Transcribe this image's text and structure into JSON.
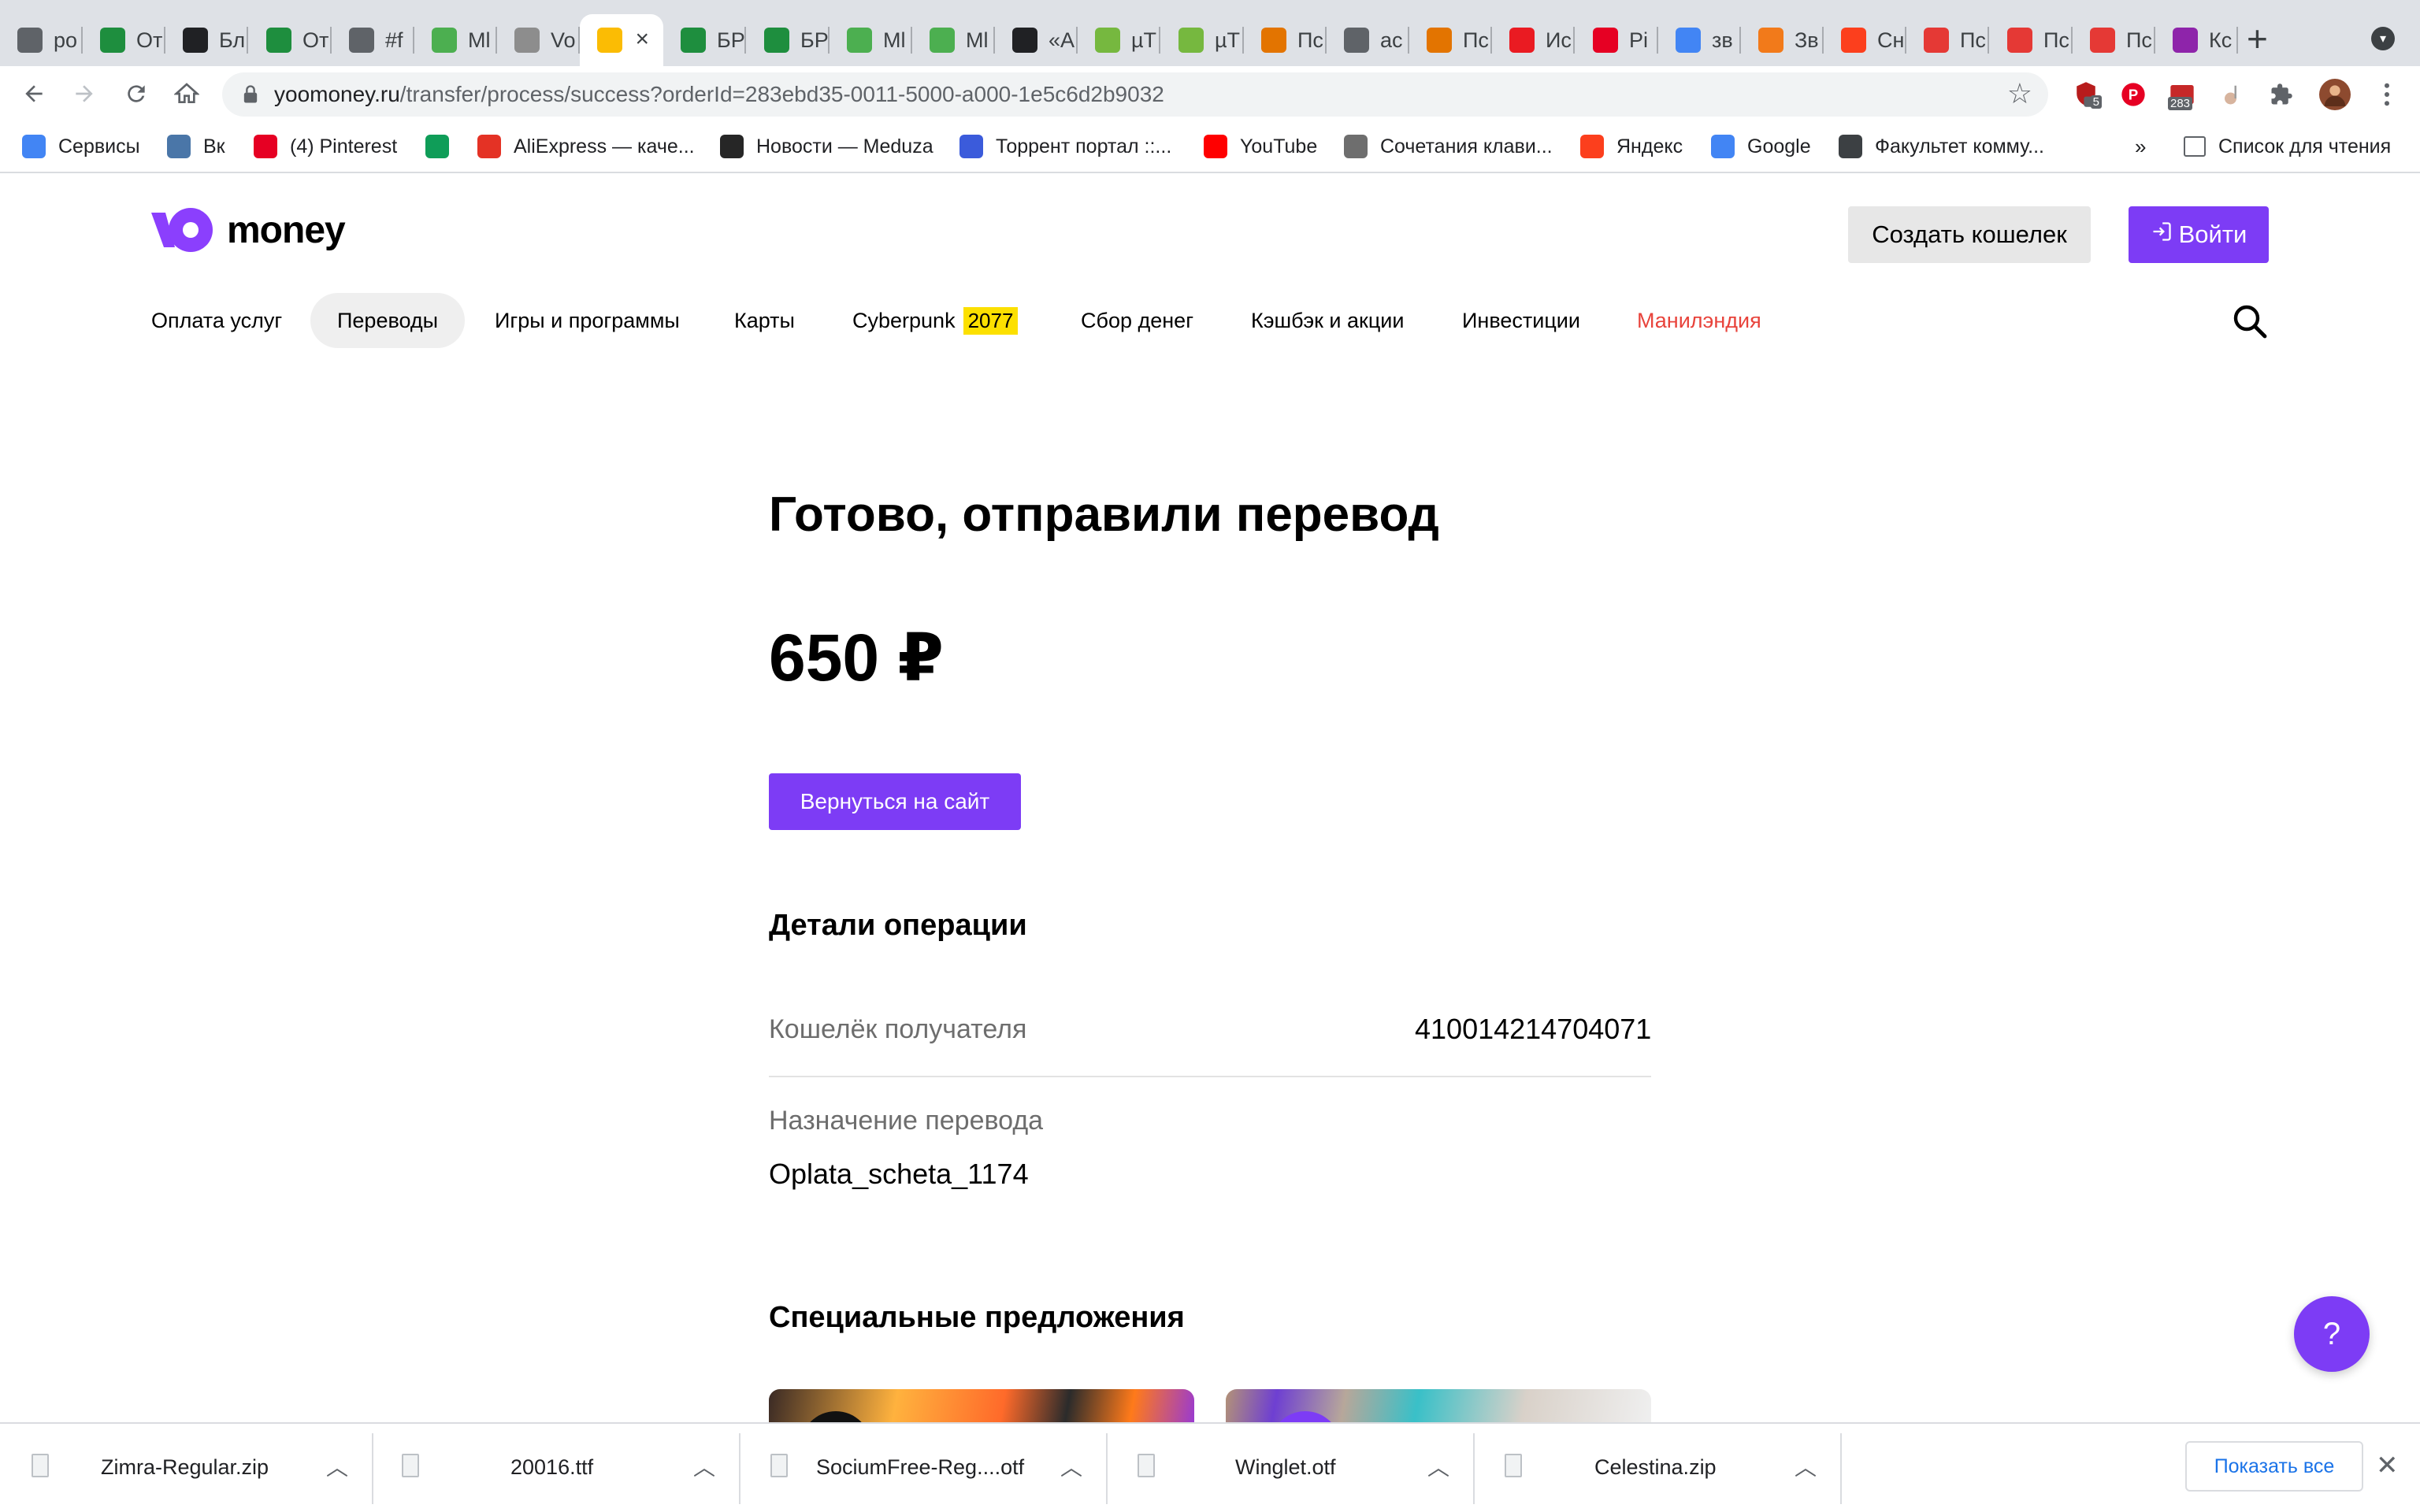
{
  "browser": {
    "tabs": [
      {
        "title": "ро",
        "icon": "feather-icon",
        "color": "#5f6368"
      },
      {
        "title": "От",
        "icon": "sheets-icon",
        "color": "#1e8e3e"
      },
      {
        "title": "Бл",
        "icon": "dark-circle-icon",
        "color": "#202124"
      },
      {
        "title": "От",
        "icon": "sheets-icon",
        "color": "#1e8e3e"
      },
      {
        "title": "#f",
        "icon": "magnet-icon",
        "color": "#5f6368"
      },
      {
        "title": "Ml",
        "icon": "play-icon",
        "color": "#4caf50"
      },
      {
        "title": "Vo",
        "icon": "globe-icon",
        "color": "#8d8d8d"
      },
      {
        "title": "",
        "icon": "warning-icon",
        "color": "#fbbc04",
        "active": true
      },
      {
        "title": "БР",
        "icon": "sheets-icon",
        "color": "#1e8e3e"
      },
      {
        "title": "БР",
        "icon": "sheets-icon",
        "color": "#1e8e3e"
      },
      {
        "title": "Ml",
        "icon": "play-icon",
        "color": "#4caf50"
      },
      {
        "title": "Ml",
        "icon": "play-icon",
        "color": "#4caf50"
      },
      {
        "title": "«А",
        "icon": "yellow-bolt-icon",
        "color": "#202124"
      },
      {
        "title": "µТ",
        "icon": "utorrent-icon",
        "color": "#76b83f"
      },
      {
        "title": "µТ",
        "icon": "utorrent-icon",
        "color": "#76b83f"
      },
      {
        "title": "Пс",
        "icon": "b-icon",
        "color": "#e37400"
      },
      {
        "title": "ас",
        "icon": "globe-icon",
        "color": "#5f6368"
      },
      {
        "title": "Пс",
        "icon": "b-icon",
        "color": "#e37400"
      },
      {
        "title": "Ис",
        "icon": "adobe-icon",
        "color": "#ea1b22"
      },
      {
        "title": "Pi",
        "icon": "pinterest-icon",
        "color": "#e60023"
      },
      {
        "title": "зв",
        "icon": "google-icon",
        "color": "#4285f4"
      },
      {
        "title": "Зв",
        "icon": "bars-icon",
        "color": "#f27a1a"
      },
      {
        "title": "Сн",
        "icon": "yandex-icon",
        "color": "#fc3f1d"
      },
      {
        "title": "Пс",
        "icon": "chart-icon",
        "color": "#e53935"
      },
      {
        "title": "Пс",
        "icon": "chart-icon",
        "color": "#e53935"
      },
      {
        "title": "Пс",
        "icon": "chart-icon",
        "color": "#e53935"
      },
      {
        "title": "Кс",
        "icon": "w-icon",
        "color": "#8e24aa"
      }
    ],
    "new_tab": "+",
    "url_host": "yoomoney.ru",
    "url_path": "/transfer/process/success?orderId=283ebd35-0011-5000-a000-1e5c6d2b9032",
    "ext_badges": {
      "extension_1": "5",
      "extension_3": "283"
    },
    "bookmarks": [
      {
        "label": "Сервисы",
        "icon": "apps-grid-icon",
        "color": "#4285f4"
      },
      {
        "label": "Вк",
        "icon": "vk-icon",
        "color": "#4a76a8"
      },
      {
        "label": "(4) Pinterest",
        "icon": "pinterest-icon",
        "color": "#e60023"
      },
      {
        "label": "",
        "icon": "google-drive-icon",
        "color": "#0f9d58"
      },
      {
        "label": "AliExpress — каче...",
        "icon": "aliexpress-icon",
        "color": "#e43225"
      },
      {
        "label": "Новости — Meduza",
        "icon": "meduza-icon",
        "color": "#262626"
      },
      {
        "label": "Торрент портал ::...",
        "icon": "butterfly-icon",
        "color": "#3b5bdb"
      },
      {
        "label": "YouTube",
        "icon": "youtube-icon",
        "color": "#ff0000"
      },
      {
        "label": "Сочетания клави...",
        "icon": "apple-icon",
        "color": "#6e6e6e"
      },
      {
        "label": "Яндекс",
        "icon": "yandex-icon",
        "color": "#fc3f1d"
      },
      {
        "label": "Google",
        "icon": "google-icon",
        "color": "#4285f4"
      },
      {
        "label": "Факультет комму...",
        "icon": "globe-icon",
        "color": "#3c4043"
      }
    ],
    "bookmarks_overflow": "»",
    "reading_list": "Список для чтения"
  },
  "site": {
    "logo_text": "money",
    "create_wallet": "Создать кошелек",
    "login": "Войти",
    "nav": [
      {
        "label": "Оплата услуг"
      },
      {
        "label": "Переводы",
        "active": true
      },
      {
        "label": "Игры и программы"
      },
      {
        "label": "Карты"
      },
      {
        "label": "Cyberpunk",
        "badge": "2077"
      },
      {
        "label": "Сбор денег"
      },
      {
        "label": "Кэшбэк и акции"
      },
      {
        "label": "Инвестиции"
      },
      {
        "label": "Манилэндия",
        "red": true
      }
    ],
    "accent": "#7d3cf5"
  },
  "main": {
    "title": "Готово, отправили перевод",
    "amount": "650 ₽",
    "back_button": "Вернуться на сайт",
    "details_title": "Детали операции",
    "recipient_label": "Кошелёк получателя",
    "recipient_value": "410014214704071",
    "purpose_label": "Назначение перевода",
    "purpose_value": "Oplata_scheta_1174",
    "offers_title": "Специальные предложения",
    "help": "?"
  },
  "downloads": {
    "items": [
      "Zimra-Regular.zip",
      "20016.ttf",
      "SociumFree-Reg....otf",
      "Winglet.otf",
      "Celestina.zip"
    ],
    "show_all": "Показать все",
    "close": "✕"
  }
}
